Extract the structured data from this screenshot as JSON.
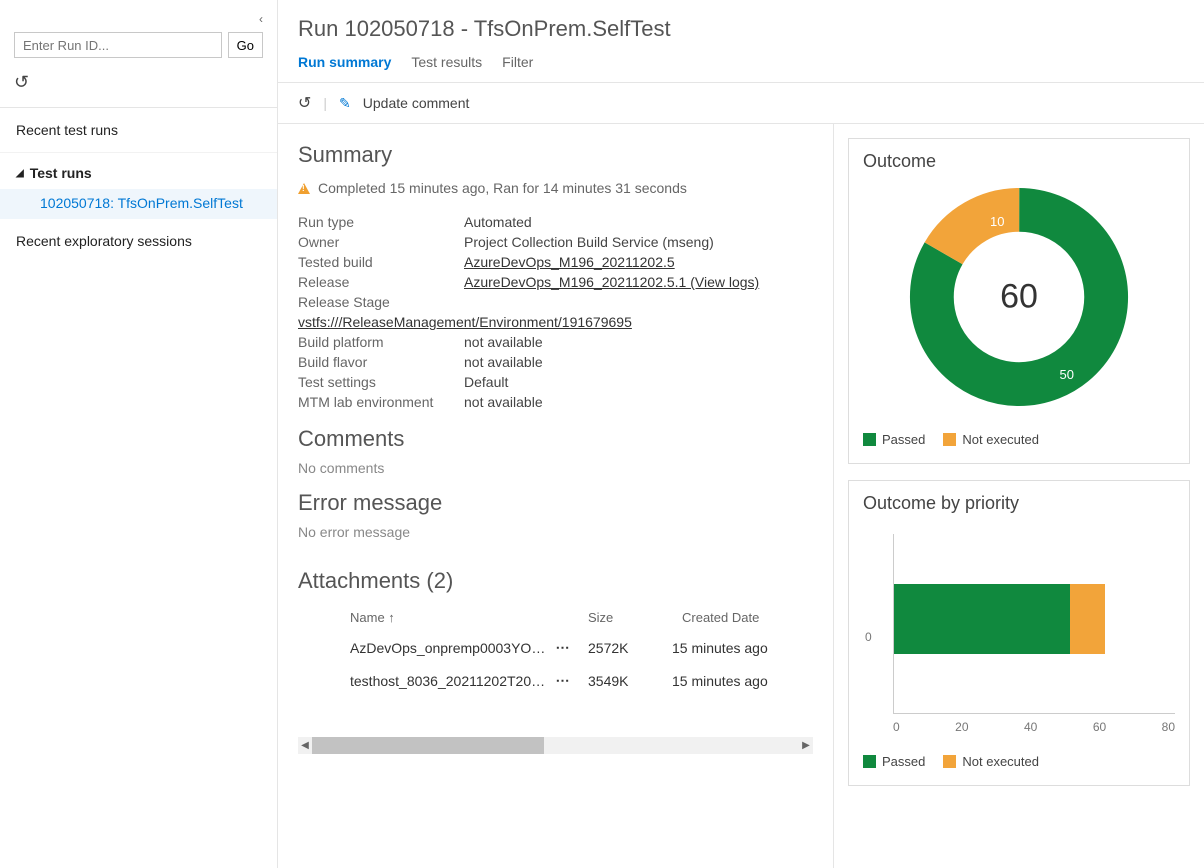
{
  "sidebar": {
    "searchPlaceholder": "Enter Run ID...",
    "goLabel": "Go",
    "nav": {
      "recentTestRuns": "Recent test runs",
      "testRuns": "Test runs",
      "recentExploratory": "Recent exploratory sessions"
    },
    "selectedRun": "102050718: TfsOnPrem.SelfTest"
  },
  "header": {
    "title": "Run 102050718 - TfsOnPrem.SelfTest",
    "tabs": {
      "summary": "Run summary",
      "results": "Test results",
      "filter": "Filter"
    },
    "updateComment": "Update comment"
  },
  "summary": {
    "heading": "Summary",
    "statusLine": "Completed 15 minutes ago, Ran for 14 minutes 31 seconds",
    "rows": {
      "runTypeLabel": "Run type",
      "runTypeValue": "Automated",
      "ownerLabel": "Owner",
      "ownerValue": "Project Collection Build Service (mseng)",
      "testedBuildLabel": "Tested build",
      "testedBuildValue": "AzureDevOps_M196_20211202.5",
      "releaseLabel": "Release",
      "releaseValue": "AzureDevOps_M196_20211202.5.1 (View logs)",
      "releaseStageLabel": "Release Stage",
      "releaseStageValue": "vstfs:///ReleaseManagement/Environment/191679695",
      "buildPlatformLabel": "Build platform",
      "buildPlatformValue": "not available",
      "buildFlavorLabel": "Build flavor",
      "buildFlavorValue": "not available",
      "testSettingsLabel": "Test settings",
      "testSettingsValue": "Default",
      "mtmLabel": "MTM lab environment",
      "mtmValue": "not available"
    },
    "commentsHeading": "Comments",
    "commentsEmpty": "No comments",
    "errorHeading": "Error message",
    "errorEmpty": "No error message"
  },
  "attachments": {
    "heading": "Attachments (2)",
    "cols": {
      "name": "Name ↑",
      "size": "Size",
      "date": "Created Date"
    },
    "rows": [
      {
        "name": "AzDevOps_onpremp0003YO…",
        "size": "2572K",
        "date": "15 minutes ago"
      },
      {
        "name": "testhost_8036_20211202T20…",
        "size": "3549K",
        "date": "15 minutes ago"
      }
    ]
  },
  "outcome": {
    "title": "Outcome",
    "total": "60",
    "legend": {
      "passed": "Passed",
      "notExecuted": "Not executed"
    }
  },
  "outcomePriority": {
    "title": "Outcome by priority",
    "yLabel": "0",
    "xTicks": [
      "0",
      "20",
      "40",
      "60",
      "80"
    ]
  },
  "chart_data": [
    {
      "type": "pie",
      "title": "Outcome",
      "series": [
        {
          "name": "Passed",
          "value": 50,
          "color": "#10893e"
        },
        {
          "name": "Not executed",
          "value": 10,
          "color": "#f2a43a"
        }
      ],
      "total": 60
    },
    {
      "type": "bar",
      "title": "Outcome by priority",
      "orientation": "horizontal",
      "xlabel": "",
      "ylabel": "",
      "xlim": [
        0,
        80
      ],
      "categories": [
        "0"
      ],
      "series": [
        {
          "name": "Passed",
          "values": [
            50
          ],
          "color": "#10893e"
        },
        {
          "name": "Not executed",
          "values": [
            10
          ],
          "color": "#f2a43a"
        }
      ]
    }
  ],
  "colors": {
    "passed": "#10893e",
    "notExecuted": "#f2a43a"
  }
}
